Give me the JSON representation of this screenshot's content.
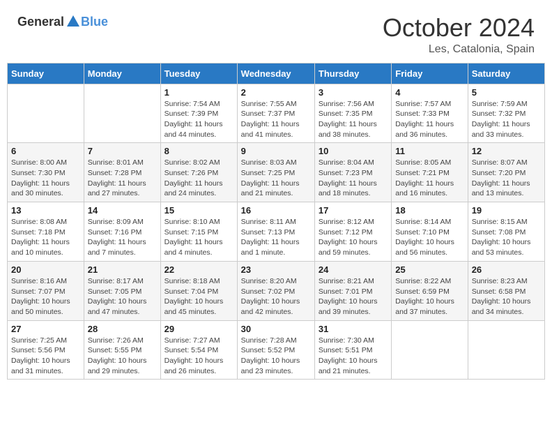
{
  "header": {
    "logo_general": "General",
    "logo_blue": "Blue",
    "month": "October 2024",
    "location": "Les, Catalonia, Spain"
  },
  "weekdays": [
    "Sunday",
    "Monday",
    "Tuesday",
    "Wednesday",
    "Thursday",
    "Friday",
    "Saturday"
  ],
  "weeks": [
    [
      {
        "day": "",
        "info": ""
      },
      {
        "day": "",
        "info": ""
      },
      {
        "day": "1",
        "info": "Sunrise: 7:54 AM\nSunset: 7:39 PM\nDaylight: 11 hours and 44 minutes."
      },
      {
        "day": "2",
        "info": "Sunrise: 7:55 AM\nSunset: 7:37 PM\nDaylight: 11 hours and 41 minutes."
      },
      {
        "day": "3",
        "info": "Sunrise: 7:56 AM\nSunset: 7:35 PM\nDaylight: 11 hours and 38 minutes."
      },
      {
        "day": "4",
        "info": "Sunrise: 7:57 AM\nSunset: 7:33 PM\nDaylight: 11 hours and 36 minutes."
      },
      {
        "day": "5",
        "info": "Sunrise: 7:59 AM\nSunset: 7:32 PM\nDaylight: 11 hours and 33 minutes."
      }
    ],
    [
      {
        "day": "6",
        "info": "Sunrise: 8:00 AM\nSunset: 7:30 PM\nDaylight: 11 hours and 30 minutes."
      },
      {
        "day": "7",
        "info": "Sunrise: 8:01 AM\nSunset: 7:28 PM\nDaylight: 11 hours and 27 minutes."
      },
      {
        "day": "8",
        "info": "Sunrise: 8:02 AM\nSunset: 7:26 PM\nDaylight: 11 hours and 24 minutes."
      },
      {
        "day": "9",
        "info": "Sunrise: 8:03 AM\nSunset: 7:25 PM\nDaylight: 11 hours and 21 minutes."
      },
      {
        "day": "10",
        "info": "Sunrise: 8:04 AM\nSunset: 7:23 PM\nDaylight: 11 hours and 18 minutes."
      },
      {
        "day": "11",
        "info": "Sunrise: 8:05 AM\nSunset: 7:21 PM\nDaylight: 11 hours and 16 minutes."
      },
      {
        "day": "12",
        "info": "Sunrise: 8:07 AM\nSunset: 7:20 PM\nDaylight: 11 hours and 13 minutes."
      }
    ],
    [
      {
        "day": "13",
        "info": "Sunrise: 8:08 AM\nSunset: 7:18 PM\nDaylight: 11 hours and 10 minutes."
      },
      {
        "day": "14",
        "info": "Sunrise: 8:09 AM\nSunset: 7:16 PM\nDaylight: 11 hours and 7 minutes."
      },
      {
        "day": "15",
        "info": "Sunrise: 8:10 AM\nSunset: 7:15 PM\nDaylight: 11 hours and 4 minutes."
      },
      {
        "day": "16",
        "info": "Sunrise: 8:11 AM\nSunset: 7:13 PM\nDaylight: 11 hours and 1 minute."
      },
      {
        "day": "17",
        "info": "Sunrise: 8:12 AM\nSunset: 7:12 PM\nDaylight: 10 hours and 59 minutes."
      },
      {
        "day": "18",
        "info": "Sunrise: 8:14 AM\nSunset: 7:10 PM\nDaylight: 10 hours and 56 minutes."
      },
      {
        "day": "19",
        "info": "Sunrise: 8:15 AM\nSunset: 7:08 PM\nDaylight: 10 hours and 53 minutes."
      }
    ],
    [
      {
        "day": "20",
        "info": "Sunrise: 8:16 AM\nSunset: 7:07 PM\nDaylight: 10 hours and 50 minutes."
      },
      {
        "day": "21",
        "info": "Sunrise: 8:17 AM\nSunset: 7:05 PM\nDaylight: 10 hours and 47 minutes."
      },
      {
        "day": "22",
        "info": "Sunrise: 8:18 AM\nSunset: 7:04 PM\nDaylight: 10 hours and 45 minutes."
      },
      {
        "day": "23",
        "info": "Sunrise: 8:20 AM\nSunset: 7:02 PM\nDaylight: 10 hours and 42 minutes."
      },
      {
        "day": "24",
        "info": "Sunrise: 8:21 AM\nSunset: 7:01 PM\nDaylight: 10 hours and 39 minutes."
      },
      {
        "day": "25",
        "info": "Sunrise: 8:22 AM\nSunset: 6:59 PM\nDaylight: 10 hours and 37 minutes."
      },
      {
        "day": "26",
        "info": "Sunrise: 8:23 AM\nSunset: 6:58 PM\nDaylight: 10 hours and 34 minutes."
      }
    ],
    [
      {
        "day": "27",
        "info": "Sunrise: 7:25 AM\nSunset: 5:56 PM\nDaylight: 10 hours and 31 minutes."
      },
      {
        "day": "28",
        "info": "Sunrise: 7:26 AM\nSunset: 5:55 PM\nDaylight: 10 hours and 29 minutes."
      },
      {
        "day": "29",
        "info": "Sunrise: 7:27 AM\nSunset: 5:54 PM\nDaylight: 10 hours and 26 minutes."
      },
      {
        "day": "30",
        "info": "Sunrise: 7:28 AM\nSunset: 5:52 PM\nDaylight: 10 hours and 23 minutes."
      },
      {
        "day": "31",
        "info": "Sunrise: 7:30 AM\nSunset: 5:51 PM\nDaylight: 10 hours and 21 minutes."
      },
      {
        "day": "",
        "info": ""
      },
      {
        "day": "",
        "info": ""
      }
    ]
  ]
}
